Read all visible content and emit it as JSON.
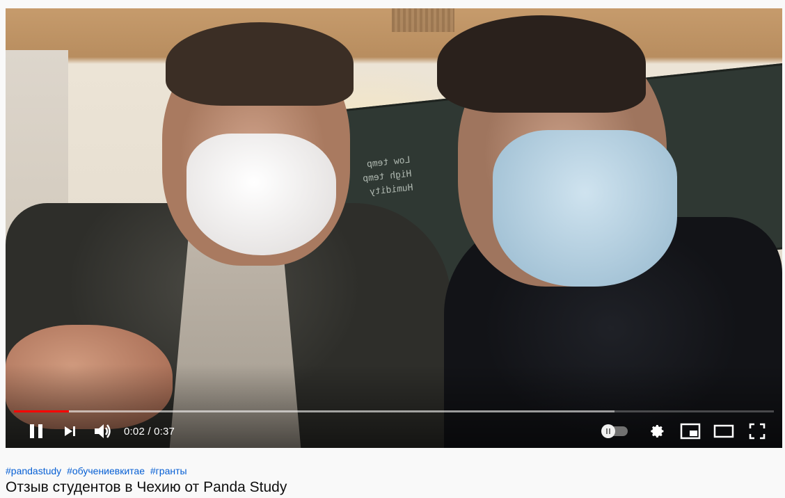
{
  "video": {
    "scene": "selfie-video-two-students-in-masks",
    "time_current": "0:02",
    "time_separator": " / ",
    "time_total": "0:37",
    "progress_played_fraction": 0.072,
    "progress_loaded_fraction": 0.79,
    "progress_color": "#ff0000"
  },
  "controls": {
    "play_pause_icon": "pause-icon",
    "next_icon": "next-icon",
    "volume_icon": "volume-icon",
    "autoplay_icon": "autoplay-toggle-icon",
    "settings_icon": "gear-icon",
    "miniplayer_icon": "miniplayer-icon",
    "theater_icon": "theater-mode-icon",
    "fullscreen_icon": "fullscreen-icon"
  },
  "hashtags": [
    "#pandastudy",
    "#обучениевкитае",
    "#гранты"
  ],
  "title": "Отзыв студентов в Чехию от Panda Study"
}
